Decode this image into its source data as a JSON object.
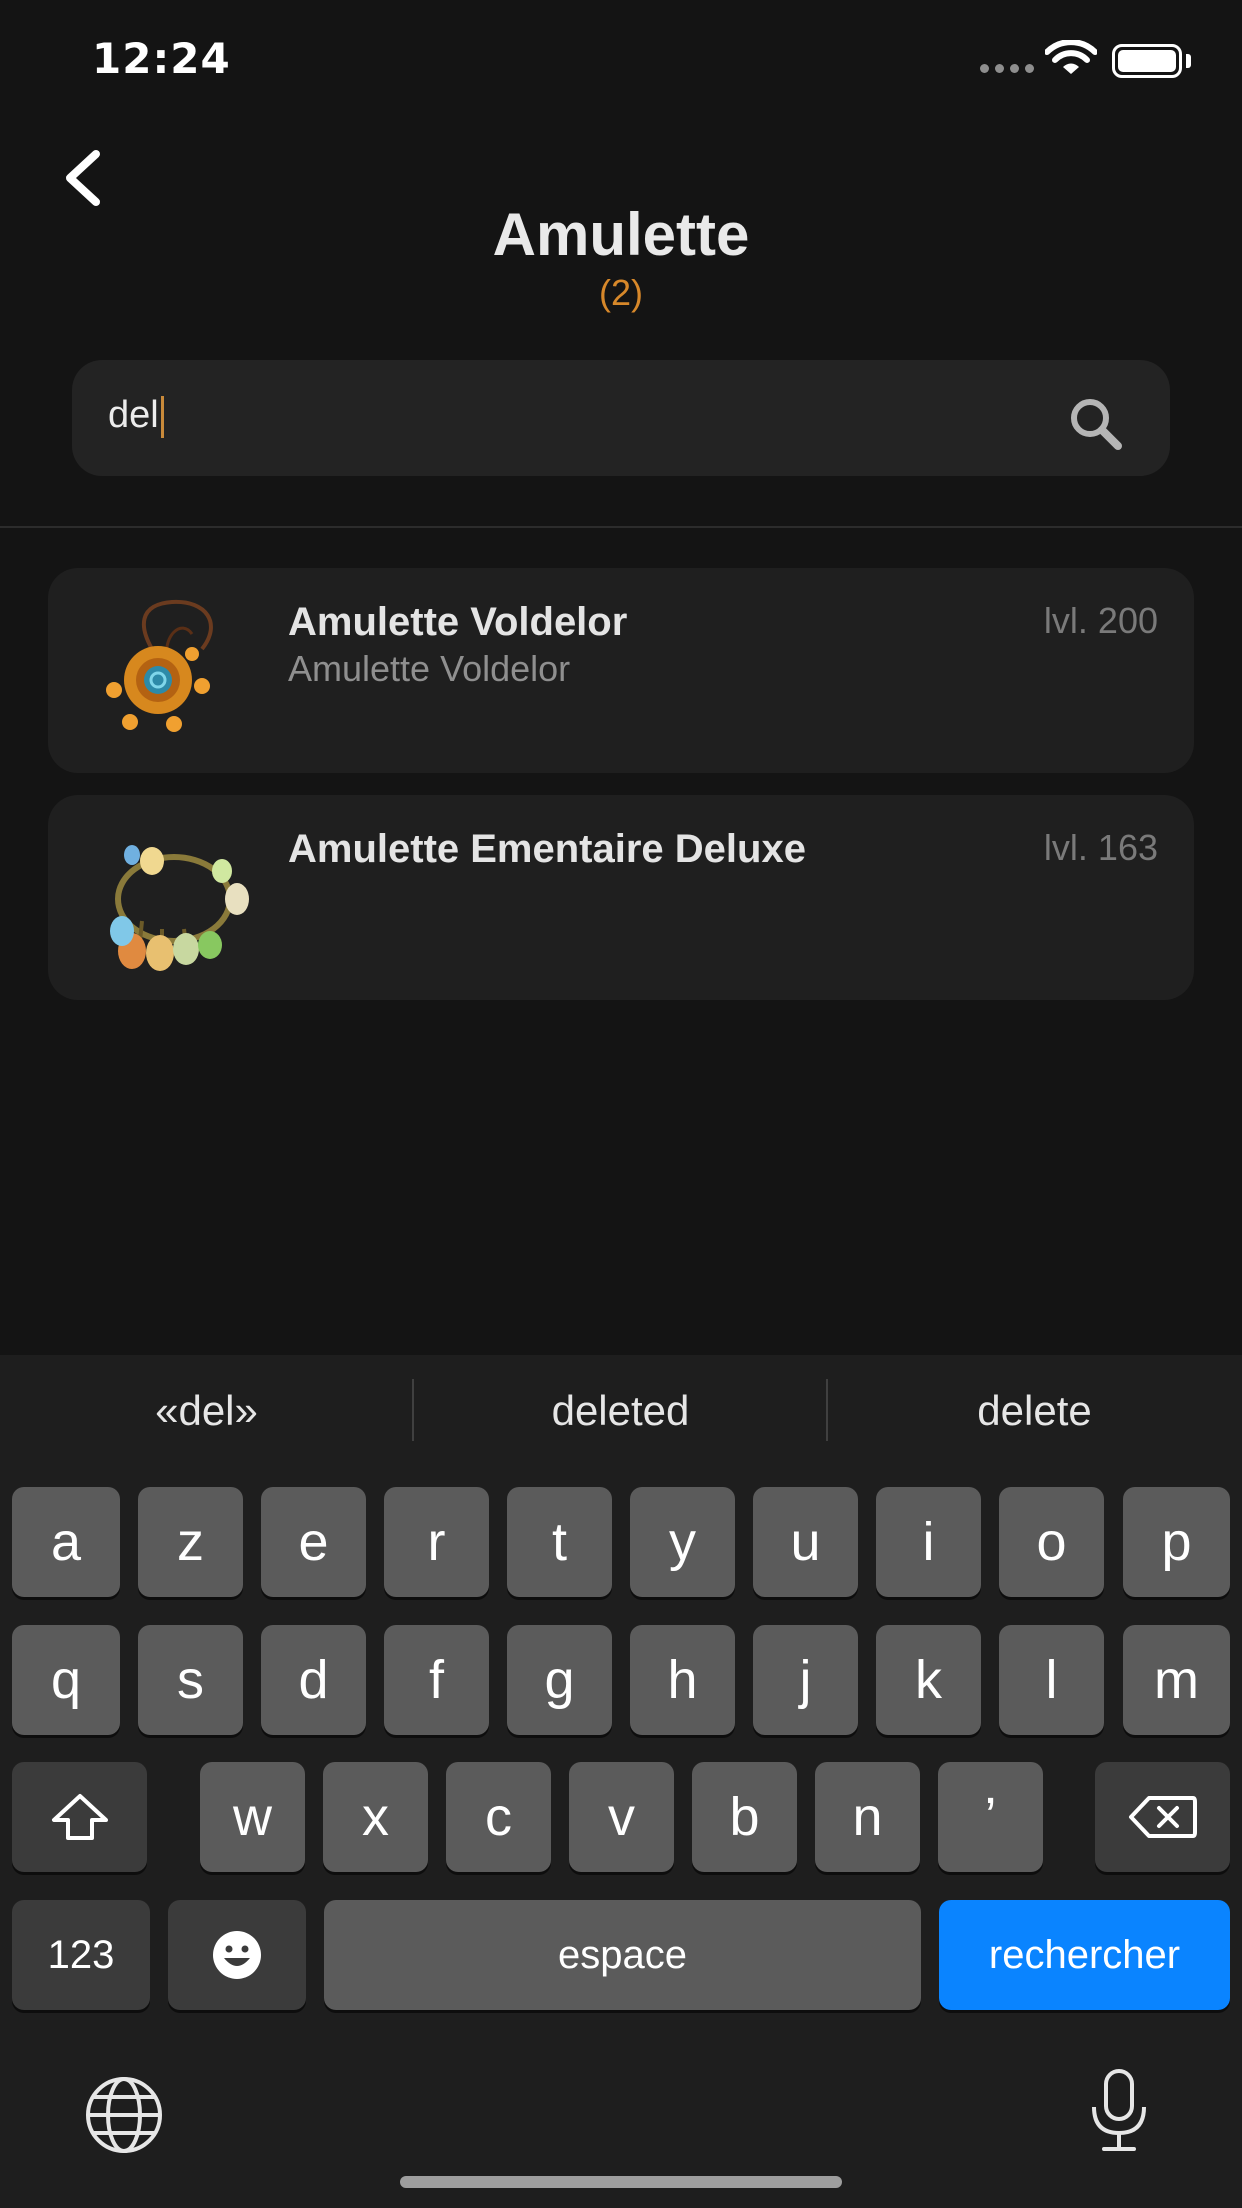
{
  "status_bar": {
    "time": "12:24"
  },
  "header": {
    "title": "Amulette",
    "count": "(2)"
  },
  "search": {
    "value": "del"
  },
  "results": [
    {
      "name": "Amulette Voldelor",
      "subtitle": "Amulette Voldelor",
      "level": "lvl. 200"
    },
    {
      "name": "Amulette Ementaire Deluxe",
      "subtitle": "",
      "level": "lvl. 163"
    }
  ],
  "keyboard": {
    "suggestions": [
      "«del»",
      "deleted",
      "delete"
    ],
    "row1": [
      "a",
      "z",
      "e",
      "r",
      "t",
      "y",
      "u",
      "i",
      "o",
      "p"
    ],
    "row2": [
      "q",
      "s",
      "d",
      "f",
      "g",
      "h",
      "j",
      "k",
      "l",
      "m"
    ],
    "row3": [
      "w",
      "x",
      "c",
      "v",
      "b",
      "n",
      "’"
    ],
    "numbers_key": "123",
    "space_key": "espace",
    "return_key": "rechercher"
  },
  "colors": {
    "accent": "#d7882a",
    "return_key": "#0a84ff",
    "background": "#141414"
  }
}
